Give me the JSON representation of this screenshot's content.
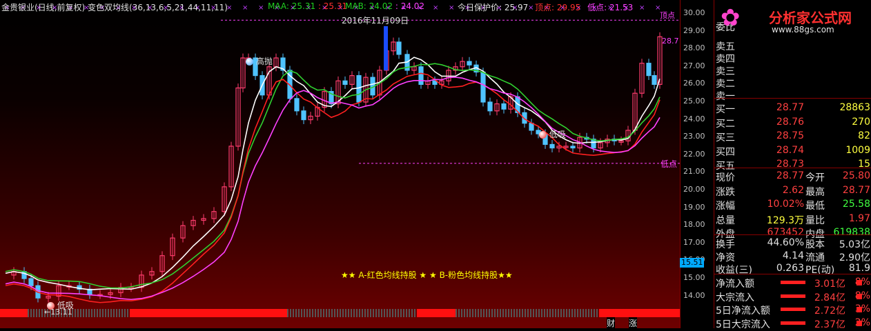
{
  "header": {
    "stock_name": "金贵银业(日线,前复权)",
    "indicator": "变色双均线(36,13,6,5,21,44,11,11)",
    "maa_label": "MAA: 25.31",
    "maa_value": "25.31",
    "mab_label": "MAB: 24.02",
    "mab_value": "24.02",
    "protect_label": "今日保护价: 25.97",
    "top_label": "顶点: 29.95",
    "low_label": "低点: 21.53"
  },
  "annotations": {
    "date_label": "2016年11月09日",
    "high_sell": "高抛",
    "low_buy_1": "低吸",
    "low_buy_2": "低吸",
    "low_point": "低点",
    "top_point": "顶点",
    "min_price": "13.11",
    "last_price_tag": "28.7",
    "current_tick": "15.51",
    "legend": "★★ A-红色均线持股 ★ ★ B-粉色均线持股★★",
    "bottom_tab_1": "财",
    "bottom_tab_2": "涨"
  },
  "price_axis": {
    "ticks": [
      "30.00",
      "29.00",
      "28.00",
      "27.00",
      "26.00",
      "25.00",
      "24.00",
      "23.00",
      "22.00",
      "21.00",
      "20.00",
      "19.00",
      "18.00",
      "17.00",
      "16.00",
      "15.00",
      "14.00"
    ]
  },
  "logo": {
    "title": "分析家公式网",
    "url": "www.88gs.com"
  },
  "quote": {
    "wei_bi": "委比",
    "sells": [
      {
        "label": "卖五",
        "price": "",
        "vol": ""
      },
      {
        "label": "卖四",
        "price": "",
        "vol": ""
      },
      {
        "label": "卖三",
        "price": "",
        "vol": ""
      },
      {
        "label": "卖二",
        "price": "",
        "vol": ""
      },
      {
        "label": "卖一",
        "price": "",
        "vol": ""
      }
    ],
    "buys": [
      {
        "label": "买一",
        "price": "28.77",
        "vol": "28863"
      },
      {
        "label": "买二",
        "price": "28.76",
        "vol": "270"
      },
      {
        "label": "买三",
        "price": "28.75",
        "vol": "82"
      },
      {
        "label": "买四",
        "price": "28.74",
        "vol": "1009"
      },
      {
        "label": "买五",
        "price": "28.73",
        "vol": "15"
      }
    ],
    "stats": [
      {
        "l1": "现价",
        "v1": "28.77",
        "l2": "今开",
        "v2": "25.80",
        "c2": "#ff4040"
      },
      {
        "l1": "涨跌",
        "v1": "2.62",
        "l2": "最高",
        "v2": "28.77",
        "c2": "#ff4040"
      },
      {
        "l1": "涨幅",
        "v1": "10.02%",
        "l2": "最低",
        "v2": "25.58",
        "c2": "#40ff40"
      },
      {
        "l1": "总量",
        "v1": "129.3万",
        "l2": "量比",
        "v2": "1.97",
        "c2": "#ff4040"
      },
      {
        "l1": "外盘",
        "v1": "673452",
        "l2": "内盘",
        "v2": "619838",
        "c2": "#40ff40"
      }
    ],
    "stats2": [
      {
        "l1": "换手",
        "v1": "44.60%",
        "l2": "股本",
        "v2": "5.03亿"
      },
      {
        "l1": "净资",
        "v1": "4.14",
        "l2": "流通",
        "v2": "2.90亿"
      },
      {
        "l1": "收益(三)",
        "v1": "0.263",
        "l2": "PE(动)",
        "v2": "81.9"
      }
    ],
    "flows": [
      {
        "label": "净流入额",
        "value": "3.01亿",
        "pct": "8%"
      },
      {
        "label": "大宗流入",
        "value": "2.84亿",
        "pct": "8%"
      },
      {
        "label": "5日净流入额",
        "value": "2.72亿",
        "pct": "3%"
      },
      {
        "label": "5日大宗流入",
        "value": "2.37亿",
        "pct": "2%"
      }
    ]
  }
}
